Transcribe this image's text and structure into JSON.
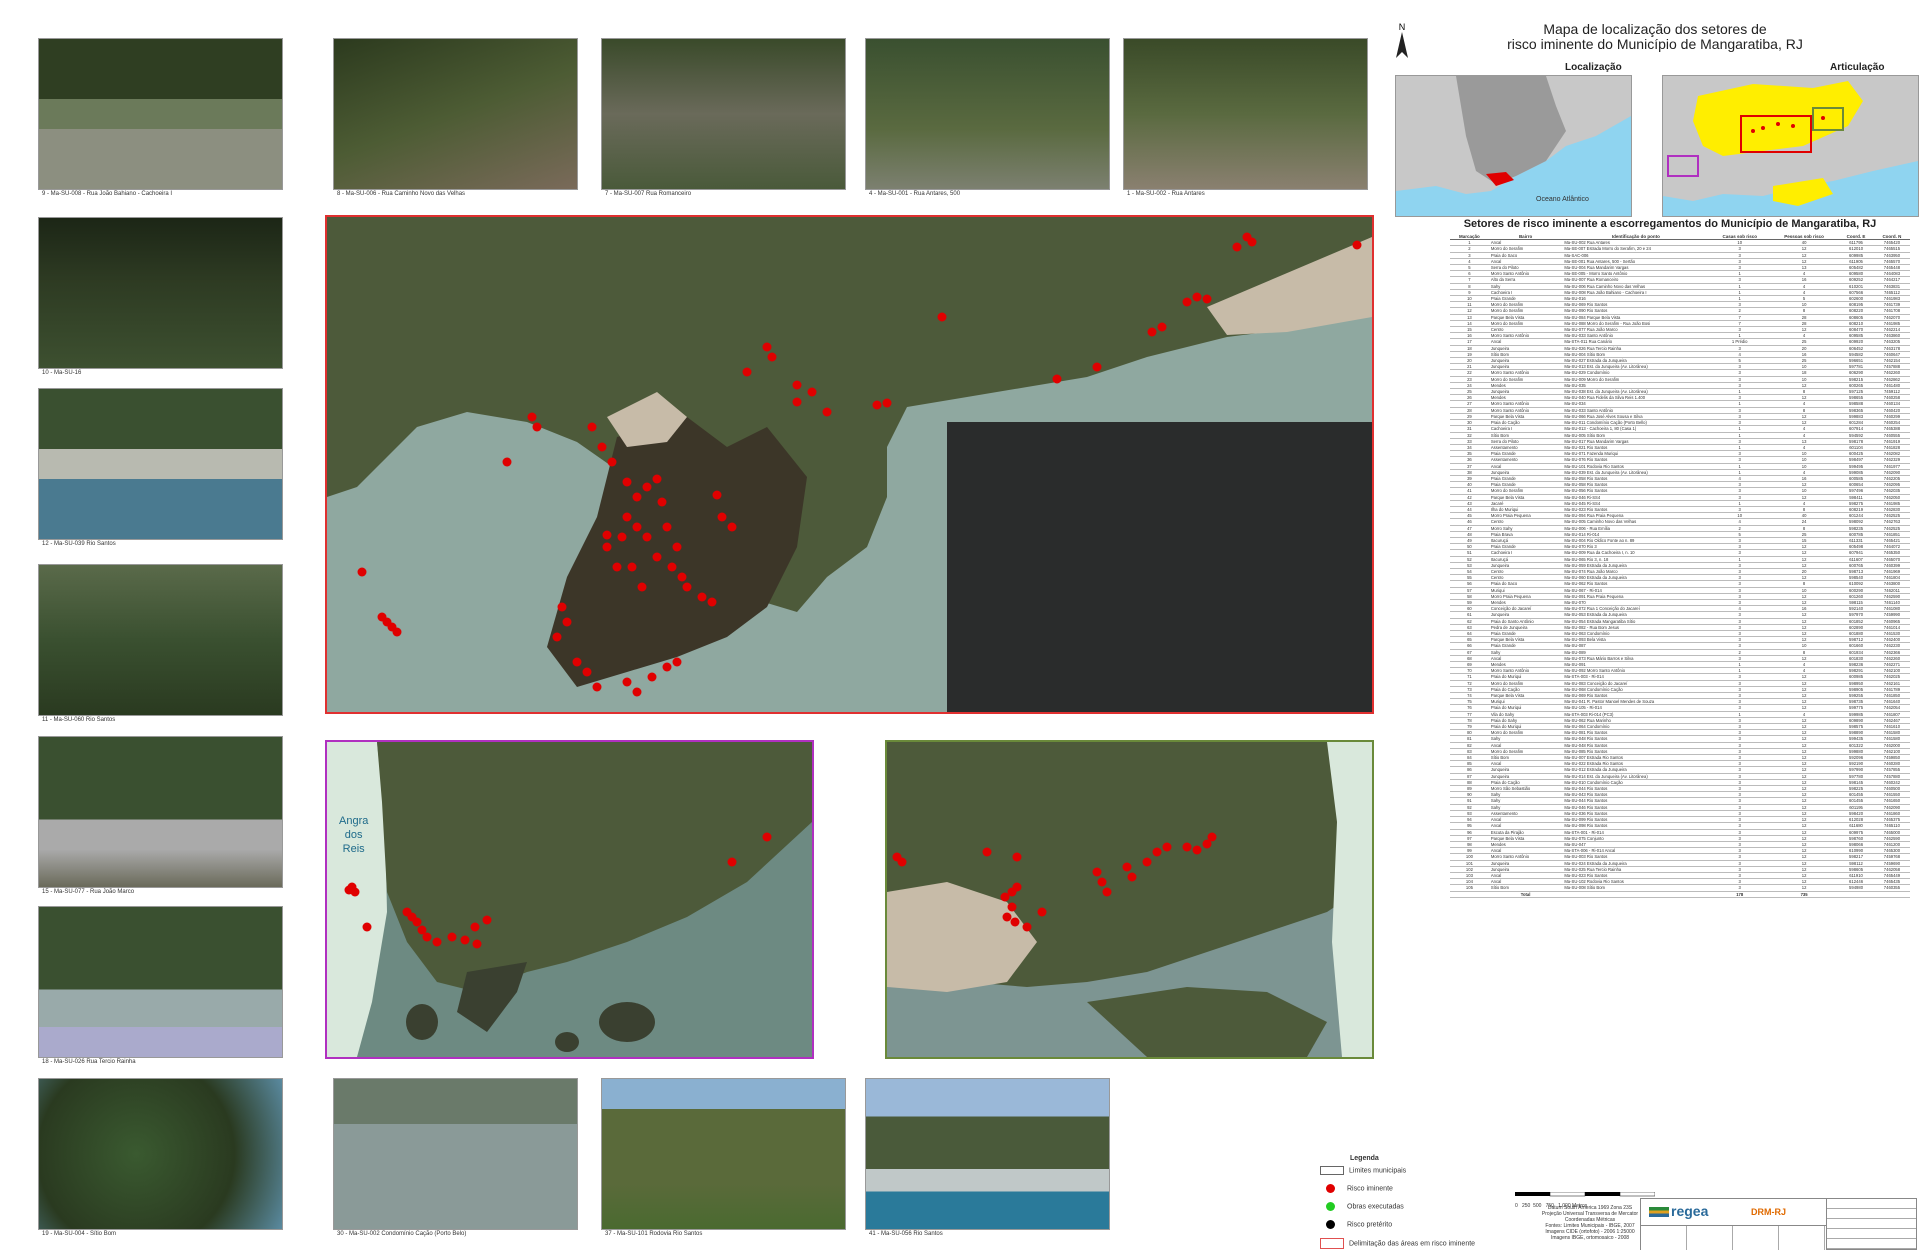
{
  "title_lines": [
    "Mapa de localização dos setores de",
    "risco iminente do Município de Mangaratiba, RJ"
  ],
  "north_label": "N",
  "inset_localizacao": {
    "title": "Localização",
    "ocean_label": "Oceano Atlântico"
  },
  "inset_articulacao": {
    "title": "Articulação"
  },
  "angra_label": [
    "Angra",
    "dos",
    "Reis"
  ],
  "table": {
    "title": "Setores de risco iminente a escorregamentos do Município de Mangaratiba, RJ",
    "headers": [
      "Marcação",
      "Bairro",
      "Identificação do ponto",
      "Casas sob risco",
      "Pessoas sob risco",
      "Coord. E",
      "Coord. N"
    ],
    "rows": [
      [
        "1",
        "Ancal",
        "Ma-SU-002 Rua Antares",
        "10",
        "40",
        "611795",
        "7465420"
      ],
      [
        "2",
        "Morro do Serafim",
        "Ma-SE-007 Estrada Morro do Serafim, 20 e 24",
        "3",
        "12",
        "612010",
        "7465515"
      ],
      [
        "3",
        "Praia do Saco",
        "Ma-SAC-006",
        "3",
        "12",
        "609985",
        "7463950"
      ],
      [
        "4",
        "Ancal",
        "Ma-SE-001 Rua Antares, 500 - Sertão",
        "3",
        "12",
        "611905",
        "7465570"
      ],
      [
        "5",
        "Serra do Piloto",
        "Ma-SU-004 Rua Mandarim Vargas",
        "3",
        "13",
        "605482",
        "7465448"
      ],
      [
        "6",
        "Morro Santo Antônio",
        "Ma-SE-005 - Morro Santo Antônio",
        "1",
        "4",
        "609580",
        "7464083"
      ],
      [
        "7",
        "Alto da Serra",
        "Ma-SU-007 Rua Romanceiro",
        "3",
        "16",
        "609252",
        "7464217"
      ],
      [
        "8",
        "Sahy",
        "Ma-SU-006 Rua Caminho Novo das Velhas",
        "1",
        "4",
        "610201",
        "7463831"
      ],
      [
        "9",
        "Cachoeira I",
        "Ma-SU-008 Rua João Bahiano - Cachoeira I",
        "1",
        "4",
        "607566",
        "7465112"
      ],
      [
        "10",
        "Praia Grande",
        "Ma-SU-016",
        "1",
        "5",
        "602600",
        "7461983"
      ],
      [
        "11",
        "Morro do Serafim",
        "Ma-SU-069 Rio Santos",
        "3",
        "10",
        "608195",
        "7461739"
      ],
      [
        "12",
        "Morro do Serafim",
        "Ma-SU-090 Rio Santos",
        "2",
        "8",
        "608220",
        "7461708"
      ],
      [
        "13",
        "Parque Bela Vista",
        "Ma-SU-084 Parque Bela Vista",
        "7",
        "28",
        "608605",
        "7462070"
      ],
      [
        "14",
        "Morro do Serafim",
        "Ma-SU-088 Morro do Serafim - Rua João Bosi",
        "7",
        "28",
        "608210",
        "7461985"
      ],
      [
        "15",
        "Centro",
        "Ma-SU-077 Rua João Marco",
        "3",
        "12",
        "608470",
        "7462214"
      ],
      [
        "16",
        "Morro Santo Antônio",
        "Ma-SU-033 Santo Antônio",
        "1",
        "4",
        "609585",
        "7463860"
      ],
      [
        "17",
        "Ancal",
        "Ma-STA-011 Rua Canário",
        "1 Prédio",
        "25",
        "609920",
        "7463205"
      ],
      [
        "18",
        "Junqueira",
        "Ma-SU-026 Rua Tercio Rainha",
        "3",
        "20",
        "606452",
        "7463178"
      ],
      [
        "19",
        "Sítio Bom",
        "Ma-SU-004 Sítio Bom",
        "4",
        "16",
        "594582",
        "7460647"
      ],
      [
        "20",
        "Junqueira",
        "Ma-SU-027 Estrada da Junqueira",
        "5",
        "25",
        "596651",
        "7462154"
      ],
      [
        "21",
        "Junqueira",
        "Ma-SU-013 Est. da Junqueira (Av. Litorânea)",
        "3",
        "10",
        "597781",
        "7457888"
      ],
      [
        "22",
        "Morro Santo Antônio",
        "Ma-SU-029 Condomínio",
        "3",
        "18",
        "606290",
        "7462260"
      ],
      [
        "23",
        "Morro do Serafim",
        "Ma-SU-009 Morro do Serafim",
        "3",
        "10",
        "598215",
        "7462862"
      ],
      [
        "24",
        "Mendes",
        "Ma-SU-035",
        "3",
        "12",
        "600265",
        "7461480"
      ],
      [
        "25",
        "Junqueira",
        "Ma-SU-038 Est. da Junqueira (Av. Litorânea)",
        "1",
        "8",
        "597125",
        "7459112"
      ],
      [
        "26",
        "Mendes",
        "Ma-SU-040 Rua Fidelis da Silva Reis 1.400",
        "3",
        "12",
        "598655",
        "7460258"
      ],
      [
        "27",
        "Morro Santo Antônio",
        "Ma-SU-034",
        "1",
        "4",
        "598588",
        "7460134"
      ],
      [
        "28",
        "Morro Santo Antônio",
        "Ma-SU-033 Santo Antônio",
        "3",
        "8",
        "598365",
        "7460420"
      ],
      [
        "29",
        "Parque Bela Vista",
        "Ma-SU-066 Rua José Alves Sousa e Silva",
        "3",
        "12",
        "599883",
        "7460299"
      ],
      [
        "30",
        "Praia do Cação",
        "Ma-SU-011 Condomínio Cação (Porto Bello)",
        "3",
        "12",
        "601284",
        "7460254"
      ],
      [
        "31",
        "Cachoeira I",
        "Ma-SU-013 - Cachoeira 1, 80 (Casa 1)",
        "1",
        "4",
        "607914",
        "7465388"
      ],
      [
        "32",
        "Sítio Bom",
        "Ma-SU-005 Sítio Bom",
        "1",
        "4",
        "594592",
        "7460555"
      ],
      [
        "33",
        "Serra do Piloto",
        "Ma-SU-017 Rua Mandarim Vargas",
        "3",
        "13",
        "598178",
        "7461919"
      ],
      [
        "34",
        "Assentamento",
        "Ma-SU-021 Rio Santos",
        "1",
        "4",
        "601104",
        "7461828"
      ],
      [
        "35",
        "Praia Grande",
        "Ma-SU-071 Fazenda Muriqui",
        "3",
        "10",
        "600425",
        "7462082"
      ],
      [
        "36",
        "Assentamento",
        "Ma-SU-076 Rio Santos",
        "3",
        "10",
        "598497",
        "7462329"
      ],
      [
        "37",
        "Ancal",
        "Ma-SU-101 Rodovia Rio Santos",
        "1",
        "10",
        "599495",
        "7461977"
      ],
      [
        "38",
        "Junqueira",
        "Ma-SU-039 Est. da Junqueira (Av. Litorânea)",
        "1",
        "4",
        "599085",
        "7462090"
      ],
      [
        "39",
        "Praia Grande",
        "Ma-SU-058 Rio Santos",
        "4",
        "16",
        "600585",
        "7462205"
      ],
      [
        "40",
        "Praia Grande",
        "Ma-SU-058 Rio Santos",
        "3",
        "12",
        "600654",
        "7462095"
      ],
      [
        "41",
        "Morro do Serafim",
        "Ma-SU-056 Rio Santos",
        "3",
        "10",
        "597496",
        "7462035"
      ],
      [
        "42",
        "Parque Bela Vista",
        "Ma-SU-046 Ri-SS4",
        "3",
        "12",
        "598411",
        "7462050"
      ],
      [
        "43",
        "Jacaré",
        "Ma-SU-045 Ri-SS4",
        "1",
        "4",
        "598275",
        "7461985"
      ],
      [
        "44",
        "Ilha do Muriqui",
        "Ma-SU-023 Rio Santos",
        "3",
        "8",
        "608219",
        "7462830"
      ],
      [
        "45",
        "Morro Praia Pequena",
        "Ma-SU-094 Rua Praia Pequena",
        "10",
        "40",
        "601244",
        "7462525"
      ],
      [
        "46",
        "Centro",
        "Ma-SU-005 Caminho Novo das Velhas",
        "4",
        "24",
        "598092",
        "7462763"
      ],
      [
        "47",
        "Morro Sahy",
        "Ma-SU-006 - Rua Emília",
        "2",
        "8",
        "598235",
        "7462525"
      ],
      [
        "48",
        "Praia Brava",
        "Ma-SU-014 Ri-014",
        "5",
        "25",
        "600785",
        "7461851"
      ],
      [
        "49",
        "Itacuruçá",
        "Ma-SU-004 Rio Oldico Fonte ao n. 89",
        "3",
        "15",
        "611331",
        "7465421"
      ],
      [
        "50",
        "Praia Grande",
        "Ma-SU-070 Rio 3",
        "3",
        "12",
        "605498",
        "7464072"
      ],
      [
        "51",
        "Cachoeira I",
        "Ma-SU-009 Rua da Cachoeira I, n. 10",
        "3",
        "12",
        "607941",
        "7465350"
      ],
      [
        "52",
        "Itacuruçá",
        "Ma-SU-065 Rio 3, n. 18",
        "1",
        "12",
        "611607",
        "7465070"
      ],
      [
        "53",
        "Junqueira",
        "Ma-SU-059 Estrada da Junqueira",
        "3",
        "12",
        "600765",
        "7460399"
      ],
      [
        "54",
        "Centro",
        "Ma-SU-074 Rua João Marco",
        "3",
        "20",
        "598713",
        "7461969"
      ],
      [
        "55",
        "Centro",
        "Ma-SU-060 Estrada da Junqueira",
        "3",
        "12",
        "598540",
        "7461804"
      ],
      [
        "56",
        "Praia do Saco",
        "Ma-SU-062 Rio Santos",
        "3",
        "8",
        "610092",
        "7463800"
      ],
      [
        "57",
        "Muriqui",
        "Ma-SU-067 - Ri-014",
        "3",
        "10",
        "600290",
        "7462011"
      ],
      [
        "58",
        "Morro Praia Pequena",
        "Ma-SU-091 Rua Praia Pequena",
        "3",
        "12",
        "601260",
        "7462590"
      ],
      [
        "59",
        "Mendes",
        "Ma-SU-070",
        "3",
        "12",
        "598115",
        "7461140"
      ],
      [
        "60",
        "Conceição do Jacareí",
        "Ma-SU-072 Rua 1 Conceição do Jacareí",
        "4",
        "16",
        "592140",
        "7461080"
      ],
      [
        "61",
        "Junqueira",
        "Ma-SU-053 Estrada da Junqueira",
        "3",
        "12",
        "597970",
        "7459990"
      ],
      [
        "62",
        "Praia do Santo Antônio",
        "Ma-SU-054 Estrada Mangaratiba Sítio",
        "3",
        "12",
        "601852",
        "7460965"
      ],
      [
        "63",
        "Pedra de Junqueira",
        "Ma-SU-082 - Rua Bom Jesus",
        "3",
        "12",
        "602890",
        "7461014"
      ],
      [
        "64",
        "Praia Grande",
        "Ma-SU-063 Condomínio",
        "3",
        "12",
        "601880",
        "7461530"
      ],
      [
        "65",
        "Parque Bela Vista",
        "Ma-SU-093 Bela Vista",
        "3",
        "12",
        "598712",
        "7462400"
      ],
      [
        "66",
        "Praia Grande",
        "Ma-SU-087",
        "3",
        "10",
        "601660",
        "7462230"
      ],
      [
        "67",
        "Sahy",
        "Ma-SU-089",
        "2",
        "8",
        "601934",
        "7462366"
      ],
      [
        "68",
        "Ancal",
        "Ma-SU-073 Rua Mário Barros e Silva",
        "3",
        "12",
        "601830",
        "7462260"
      ],
      [
        "69",
        "Mendes",
        "Ma-SU-091",
        "1",
        "4",
        "598236",
        "7462271"
      ],
      [
        "70",
        "Morro Santo Antônio",
        "Ma-SU-092 Morro Santo Antônio",
        "1",
        "4",
        "598291",
        "7462100"
      ],
      [
        "71",
        "Praia do Muriqui",
        "Ma-STA-003 - Ri-014",
        "3",
        "12",
        "600985",
        "7462025"
      ],
      [
        "72",
        "Morro do Serafim",
        "Ma-SU-083 Conceição do Jacareí",
        "3",
        "12",
        "598950",
        "7462161"
      ],
      [
        "73",
        "Praia do Cação",
        "Ma-SU-068 Condomínio Cação",
        "3",
        "12",
        "598905",
        "7461789"
      ],
      [
        "74",
        "Parque Bela Vista",
        "Ma-SU-069 Rio Santos",
        "3",
        "12",
        "599255",
        "7461850"
      ],
      [
        "75",
        "Muriqui",
        "Ma-SU-041 R. Pastor Manoel Mendes de Souza",
        "3",
        "12",
        "598735",
        "7461640"
      ],
      [
        "76",
        "Praia do Muriqui",
        "Ma-SU-105 - Ri-014",
        "3",
        "12",
        "599775",
        "7462054"
      ],
      [
        "77",
        "Vila do Sahy",
        "Ma-STA-003 Ri-014 (PC3)",
        "1",
        "4",
        "599985",
        "7461807"
      ],
      [
        "78",
        "Praia do Sahy",
        "Ma-SU-062 Rua Marinho",
        "3",
        "12",
        "609890",
        "7462467"
      ],
      [
        "79",
        "Praia do Muriqui",
        "Ma-SU-064 Condomínio",
        "3",
        "12",
        "598575",
        "7461610"
      ],
      [
        "80",
        "Morro do Serafim",
        "Ma-SU-081 Rio Santos",
        "3",
        "12",
        "598890",
        "7461580"
      ],
      [
        "81",
        "Sahy",
        "Ma-SU-048 Rio Santos",
        "3",
        "12",
        "599435",
        "7461580"
      ],
      [
        "82",
        "Ancal",
        "Ma-SU-048 Rio Santos",
        "3",
        "12",
        "601322",
        "7462000"
      ],
      [
        "83",
        "Morro do Serafim",
        "Ma-SU-085 Rio Santos",
        "3",
        "12",
        "599880",
        "7462100"
      ],
      [
        "84",
        "Sítio Bom",
        "Ma-SU-007 Estrada Rio Santos",
        "3",
        "12",
        "592096",
        "7459850"
      ],
      [
        "85",
        "Ancal",
        "Ma-SU-022 Estrada Rio Santos",
        "3",
        "12",
        "592190",
        "7460280"
      ],
      [
        "86",
        "Junqueira",
        "Ma-SU-012 Estrada da Junqueira",
        "3",
        "12",
        "597990",
        "7457855"
      ],
      [
        "87",
        "Junqueira",
        "Ma-SU-014 Est. da Junqueira (Av. Litorânea)",
        "3",
        "12",
        "597780",
        "7457880"
      ],
      [
        "88",
        "Praia do Cação",
        "Ma-SU-010 Condomínio Cação",
        "3",
        "12",
        "598145",
        "7460242"
      ],
      [
        "89",
        "Morro São Sebastião",
        "Ma-SU-044 Rio Santos",
        "3",
        "12",
        "598225",
        "7460500"
      ],
      [
        "90",
        "Sahy",
        "Ma-SU-043 Rio Santos",
        "3",
        "12",
        "601455",
        "7461550"
      ],
      [
        "91",
        "Sahy",
        "Ma-SU-044 Rio Santos",
        "3",
        "12",
        "601455",
        "7461650"
      ],
      [
        "92",
        "Sahy",
        "Ma-SU-046 Rio Santos",
        "3",
        "12",
        "601195",
        "7462090"
      ],
      [
        "93",
        "Assentamento",
        "Ma-SU-036 Rio Santos",
        "3",
        "12",
        "598420",
        "7461860"
      ],
      [
        "94",
        "Ancal",
        "Ma-SU-099 Rio Santos",
        "3",
        "12",
        "612028",
        "7465375"
      ],
      [
        "95",
        "Ancal",
        "Ma-SU-098 Rio Santos",
        "3",
        "12",
        "611680",
        "7465110"
      ],
      [
        "96",
        "Escuta da Pirajão",
        "Ma-STA-001 - Ri-014",
        "3",
        "12",
        "609975",
        "7465000"
      ],
      [
        "97",
        "Parque Bela Vista",
        "Ma-SU-075 Conjunto",
        "3",
        "12",
        "598760",
        "7462590"
      ],
      [
        "98",
        "Mendes",
        "Ma-SU-047",
        "3",
        "12",
        "598066",
        "7461200"
      ],
      [
        "99",
        "Ancal",
        "Ma-STA-006 - Ri-014 Ancal",
        "3",
        "12",
        "610990",
        "7465300"
      ],
      [
        "100",
        "Morro Santo Antônio",
        "Ma-SU-003 Rio Santos",
        "3",
        "12",
        "598217",
        "7459768"
      ],
      [
        "101",
        "Junqueira",
        "Ma-SU-024 Estrada da Junqueira",
        "3",
        "12",
        "598112",
        "7459690"
      ],
      [
        "102",
        "Junqueira",
        "Ma-SU-025 Rua Tercio Rainha",
        "3",
        "12",
        "598605",
        "7462058"
      ],
      [
        "103",
        "Ancal",
        "Ma-SU-023 Rio Santos",
        "3",
        "12",
        "611910",
        "7465449"
      ],
      [
        "104",
        "Ancal",
        "Ma-SU-102 Rodovia Rio Santos",
        "3",
        "12",
        "612446",
        "7465435"
      ],
      [
        "105",
        "Sítio Bom",
        "Ma-SU-008 Sítio Bom",
        "3",
        "12",
        "594980",
        "7460355"
      ]
    ],
    "total_label": "Total",
    "total_casas": "178",
    "total_pessoas": "735"
  },
  "photos": [
    {
      "caption": "9 - Ma-SU-008 - Rua João Bahiano - Cachoeira I"
    },
    {
      "caption": "8 - Ma-SU-006 - Rua Caminho Novo das Velhas"
    },
    {
      "caption": "7 - Ma-SU-007 Rua Romanceiro"
    },
    {
      "caption": "4 - Ma-SU-001 - Rua Antares, 500"
    },
    {
      "caption": "1 - Ma-SU-002 - Rua Antares"
    },
    {
      "caption": "10 - Ma-SU-16"
    },
    {
      "caption": "12 - Ma-SU-039 Rio Santos"
    },
    {
      "caption": "11 - Ma-SU-060 Rio Santos"
    },
    {
      "caption": "15 - Ma-SU-077 - Rua João Marco"
    },
    {
      "caption": "18 - Ma-SU-026 Rua Tercio Rainha"
    },
    {
      "caption": "19 - Ma-SU-004 - Sítio Bom"
    },
    {
      "caption": "30 - Ma-SU-002 Condomínio Cação (Porto Belo)"
    },
    {
      "caption": "37 - Ma-SU-101 Rodovia Rio Santos"
    },
    {
      "caption": "41 - Ma-SU-056 Rio Santos"
    }
  ],
  "legend": {
    "title": "Legenda",
    "items": [
      {
        "label": "Limites municipais",
        "color": "#ffffff"
      },
      {
        "label": "Risco iminente",
        "color": "#e00000"
      },
      {
        "label": "Obras executadas",
        "color": "#22cc22"
      },
      {
        "label": "Risco pretérito",
        "color": "#000000"
      },
      {
        "label": "Delimitação das áreas em risco iminente",
        "color": "#e05050"
      }
    ]
  },
  "scale_text": "0   250  500   750   1.000 Metros",
  "datum_lines": [
    "Datum South America 1969 Zona 23S",
    "Projeção Universal Transversa de Mercator",
    "Coordenadas Métricas",
    "Fontes: Limites Municipais - IBGE, 2007",
    "Imagens CIDE (ortofoto) - 2006 1:25000",
    "Imagens IBGE, ortomosaico - 2008"
  ],
  "logos": {
    "regea": "regea",
    "drm": "DRM-RJ"
  },
  "colors": {
    "risk_dot": "#e00000",
    "main_frame": "#e03030",
    "west_frame": "#b030c0",
    "east_frame": "#6a8a3a",
    "water": "#8fa8a0",
    "land": "#4d5a3a",
    "dark_sea": "#2a2c2c",
    "urban": "#c7bba8"
  }
}
